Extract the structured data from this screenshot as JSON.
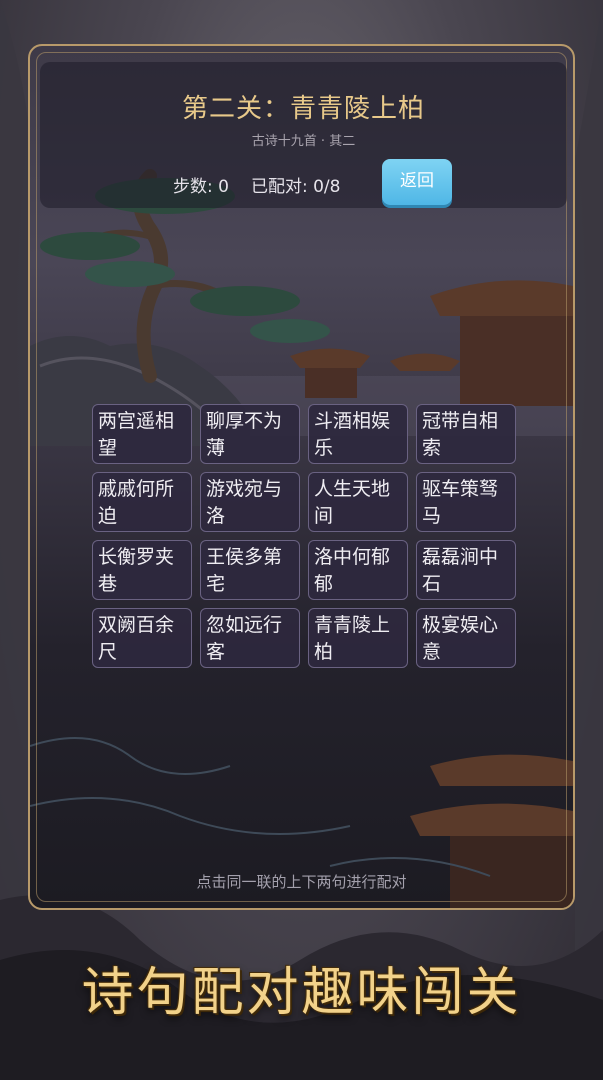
{
  "header": {
    "title": "第二关：青青陵上柏",
    "subtitle": "古诗十九首 · 其二",
    "steps_label": "步数: 0",
    "matched_label": "已配对: 0/8",
    "back_label": "返回"
  },
  "cards": [
    "两宫遥相望",
    "聊厚不为薄",
    "斗酒相娱乐",
    "冠带自相索",
    "戚戚何所迫",
    "游戏宛与洛",
    "人生天地间",
    "驱车策驽马",
    "长衡罗夹巷",
    "王侯多第宅",
    "洛中何郁郁",
    "磊磊涧中石",
    "双阙百余尺",
    "忽如远行客",
    "青青陵上柏",
    "极宴娱心意"
  ],
  "hint": "点击同一联的上下两句进行配对",
  "banner": "诗句配对趣味闯关",
  "colors": {
    "accent": "#e8c98a",
    "button": "#4fb7e6",
    "banner": "#f2d28a"
  }
}
